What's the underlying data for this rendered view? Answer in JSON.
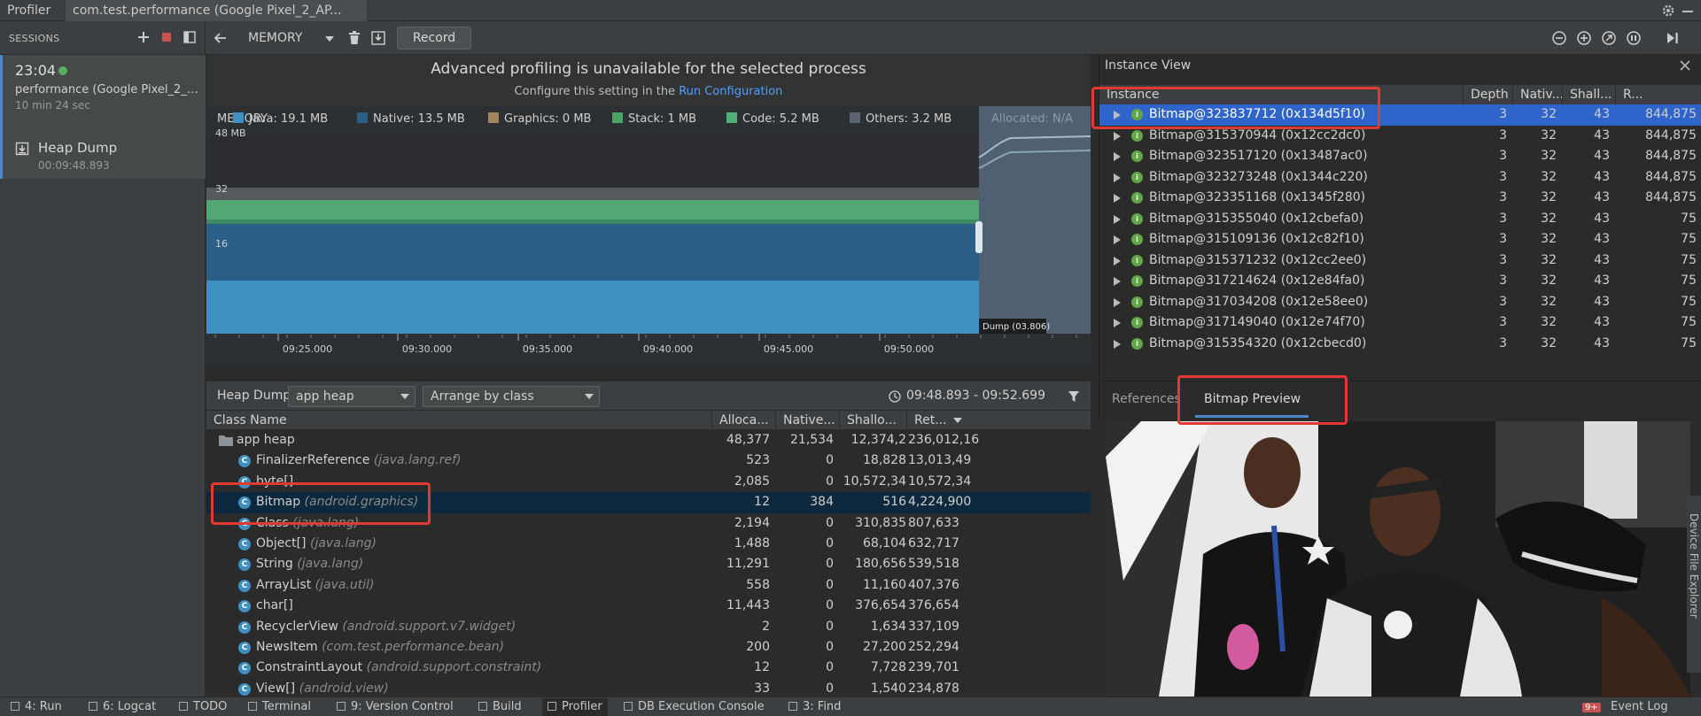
{
  "top_tabs": {
    "profiler": "Profiler",
    "session": "com.test.performance (Google Pixel_2_AP..."
  },
  "sessions": {
    "label": "SESSIONS",
    "card": {
      "time": "23:04",
      "name": "performance (Google Pixel_2_A...",
      "duration": "10 min 24 sec"
    },
    "heap_dump": {
      "label": "Heap Dump",
      "time": "00:09:48.893"
    }
  },
  "toolbar": {
    "profiler_select": "MEMORY",
    "record_label": "Record"
  },
  "banner": {
    "title": "Advanced profiling is unavailable for the selected process",
    "subtitle_prefix": "Configure this setting in the ",
    "subtitle_link": "Run Configuration"
  },
  "memory_chart": {
    "label": "MEMORY",
    "max_label": "48 MB",
    "y_ticks": [
      "32",
      "16"
    ],
    "legend": [
      {
        "text": "Java: 19.1 MB",
        "color": "#3f8fc2"
      },
      {
        "text": "Native: 13.5 MB",
        "color": "#2c5f87"
      },
      {
        "text": "Graphics: 0 MB",
        "color": "#a0845c"
      },
      {
        "text": "Stack: 1 MB",
        "color": "#4aa56a"
      },
      {
        "text": "Code: 5.2 MB",
        "color": "#4fae7a"
      },
      {
        "text": "Others: 3.2 MB",
        "color": "#5a656f"
      }
    ],
    "allocated": "Allocated: N/A",
    "x_ticks": [
      "09:25.000",
      "09:30.000",
      "09:35.000",
      "09:40.000",
      "09:45.000",
      "09:50.000"
    ],
    "dump_label": "Dump (03.806)"
  },
  "heap_bar": {
    "label": "Heap Dump",
    "heap_select": "app heap",
    "arrange_select": "Arrange by class",
    "range": "09:48.893 - 09:52.699"
  },
  "class_table": {
    "headers": [
      "Class Name",
      "Alloca...",
      "Native...",
      "Shallo...",
      "Ret..."
    ],
    "rows": [
      {
        "name": "app heap",
        "pkg": "",
        "alloc": "48,377",
        "native": "21,534",
        "shallow": "12,374,2",
        "retained": "236,012,16",
        "icon": "folder"
      },
      {
        "name": "FinalizerReference",
        "pkg": "(java.lang.ref)",
        "alloc": "523",
        "native": "0",
        "shallow": "18,828",
        "retained": "13,013,49",
        "icon": "class"
      },
      {
        "name": "byte[]",
        "pkg": "",
        "alloc": "2,085",
        "native": "0",
        "shallow": "10,572,34",
        "retained": "10,572,34",
        "icon": "class"
      },
      {
        "name": "Bitmap",
        "pkg": "(android.graphics)",
        "alloc": "12",
        "native": "384",
        "shallow": "516",
        "retained": "4,224,900",
        "icon": "class",
        "selected": true
      },
      {
        "name": "Class",
        "pkg": "(java.lang)",
        "alloc": "2,194",
        "native": "0",
        "shallow": "310,835",
        "retained": "807,633",
        "icon": "class"
      },
      {
        "name": "Object[]",
        "pkg": "(java.lang)",
        "alloc": "1,488",
        "native": "0",
        "shallow": "68,104",
        "retained": "632,717",
        "icon": "class"
      },
      {
        "name": "String",
        "pkg": "(java.lang)",
        "alloc": "11,291",
        "native": "0",
        "shallow": "180,656",
        "retained": "539,518",
        "icon": "class"
      },
      {
        "name": "ArrayList",
        "pkg": "(java.util)",
        "alloc": "558",
        "native": "0",
        "shallow": "11,160",
        "retained": "407,376",
        "icon": "class"
      },
      {
        "name": "char[]",
        "pkg": "",
        "alloc": "11,443",
        "native": "0",
        "shallow": "376,654",
        "retained": "376,654",
        "icon": "class"
      },
      {
        "name": "RecyclerView",
        "pkg": "(android.support.v7.widget)",
        "alloc": "2",
        "native": "0",
        "shallow": "1,634",
        "retained": "337,109",
        "icon": "class"
      },
      {
        "name": "NewsItem",
        "pkg": "(com.test.performance.bean)",
        "alloc": "200",
        "native": "0",
        "shallow": "27,200",
        "retained": "252,294",
        "icon": "class"
      },
      {
        "name": "ConstraintLayout",
        "pkg": "(android.support.constraint)",
        "alloc": "12",
        "native": "0",
        "shallow": "7,728",
        "retained": "239,701",
        "icon": "class"
      },
      {
        "name": "View[]",
        "pkg": "(android.view)",
        "alloc": "33",
        "native": "0",
        "shallow": "1,540",
        "retained": "234,878",
        "icon": "class"
      }
    ]
  },
  "instance_view": {
    "title": "Instance View",
    "headers": [
      "Instance",
      "Depth",
      "Nativ...",
      "Shall...",
      "R..."
    ],
    "rows": [
      {
        "name": "Bitmap@323837712 (0x134d5f10)",
        "depth": "3",
        "native": "32",
        "shallow": "43",
        "retained": "844,875",
        "selected": true
      },
      {
        "name": "Bitmap@315370944 (0x12cc2dc0)",
        "depth": "3",
        "native": "32",
        "shallow": "43",
        "retained": "844,875"
      },
      {
        "name": "Bitmap@323517120 (0x13487ac0)",
        "depth": "3",
        "native": "32",
        "shallow": "43",
        "retained": "844,875"
      },
      {
        "name": "Bitmap@323273248 (0x1344c220)",
        "depth": "3",
        "native": "32",
        "shallow": "43",
        "retained": "844,875"
      },
      {
        "name": "Bitmap@323351168 (0x1345f280)",
        "depth": "3",
        "native": "32",
        "shallow": "43",
        "retained": "844,875"
      },
      {
        "name": "Bitmap@315355040 (0x12cbefa0)",
        "depth": "3",
        "native": "32",
        "shallow": "43",
        "retained": "75"
      },
      {
        "name": "Bitmap@315109136 (0x12c82f10)",
        "depth": "3",
        "native": "32",
        "shallow": "43",
        "retained": "75"
      },
      {
        "name": "Bitmap@315371232 (0x12cc2ee0)",
        "depth": "3",
        "native": "32",
        "shallow": "43",
        "retained": "75"
      },
      {
        "name": "Bitmap@317214624 (0x12e84fa0)",
        "depth": "3",
        "native": "32",
        "shallow": "43",
        "retained": "75"
      },
      {
        "name": "Bitmap@317034208 (0x12e58ee0)",
        "depth": "3",
        "native": "32",
        "shallow": "43",
        "retained": "75"
      },
      {
        "name": "Bitmap@317149040 (0x12e74f70)",
        "depth": "3",
        "native": "32",
        "shallow": "43",
        "retained": "75"
      },
      {
        "name": "Bitmap@315354320 (0x12cbecd0)",
        "depth": "3",
        "native": "32",
        "shallow": "43",
        "retained": "75"
      }
    ]
  },
  "detail_tabs": {
    "references": "References",
    "bitmap_preview": "Bitmap Preview"
  },
  "side_tool": "Device File Explorer",
  "bottom_bar": {
    "items": [
      {
        "text": "4: Run",
        "icon": "play-icon"
      },
      {
        "text": "6: Logcat",
        "icon": "logcat-icon"
      },
      {
        "text": "TODO",
        "icon": "todo-icon"
      },
      {
        "text": "Terminal",
        "icon": "terminal-icon"
      },
      {
        "text": "9: Version Control",
        "icon": "vcs-icon"
      },
      {
        "text": "Build",
        "icon": "hammer-icon"
      },
      {
        "text": "Profiler",
        "icon": "profiler-icon",
        "active": true
      },
      {
        "text": "DB Execution Console",
        "icon": "database-icon"
      },
      {
        "text": "3: Find",
        "icon": "search-icon"
      }
    ],
    "event_log": "Event Log",
    "event_badge": "9+"
  }
}
